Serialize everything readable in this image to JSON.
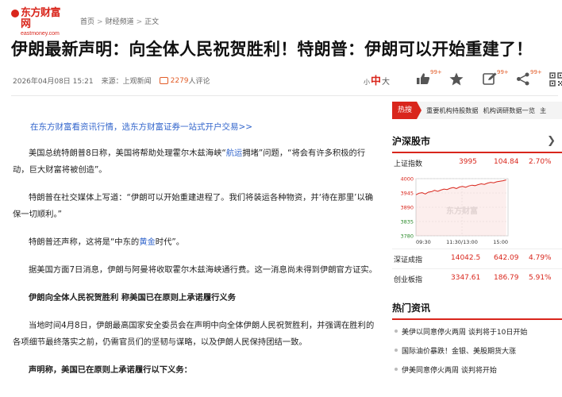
{
  "header": {
    "logo_cn": "东方财富网",
    "logo_en": "eastmoney.com",
    "breadcrumb": [
      "首页",
      "财经频道",
      "正文"
    ],
    "breadcrumb_sep": ">"
  },
  "article": {
    "title": "伊朗最新声明：向全体人民祝贺胜利！特朗普：伊朗可以开始重建了！",
    "datetime": "2026年04月08日 15:21",
    "source": "来源：上观新闻",
    "comment_count": "2279",
    "comment_suffix": "人评论",
    "font_size": {
      "small": "小",
      "mid": "中",
      "large": "大"
    },
    "actions": [
      {
        "icon": "thumbs-up-icon",
        "badge": "99+"
      },
      {
        "icon": "star-icon",
        "badge": ""
      },
      {
        "icon": "edit-icon",
        "badge": "99+"
      },
      {
        "icon": "share-icon",
        "badge": "99+"
      },
      {
        "icon": "qrcode-icon",
        "badge": ""
      }
    ],
    "promo": "在东方财富看资讯行情，选东方财富证券一站式开户交易>>",
    "p1_a": "美国总统特朗普8日称，美国将帮助处理霍尔木兹海峡“",
    "p1_link": "航运",
    "p1_b": "拥堵”问题，“将会有许多积极的行动，巨大财富将被创造”。",
    "p2": "特朗普在社交媒体上写道：“伊朗可以开始重建进程了。我们将装运各种物资，并‘待在那里’以确保一切顺利。”",
    "p3_a": "特朗普还声称，这将是“中东的",
    "p3_link": "黄金",
    "p3_b": "时代”。",
    "p4": "据美国方面7日消息，伊朗与阿曼将收取霍尔木兹海峡通行费。这一消息尚未得到伊朗官方证实。",
    "h1": "伊朗向全体人民祝贺胜利 称美国已在原则上承诺履行义务",
    "p5": "当地时间4月8日，伊朗最高国家安全委员会在声明中向全体伊朗人民祝贺胜利，并强调在胜利的各项细节最终落实之前，仍需官员们的坚韧与谋略，以及伊朗人民保持团结一致。",
    "h2": "声明称，美国已在原则上承诺履行以下义务："
  },
  "sidebar": {
    "hot_label": "热搜",
    "hot_items": [
      "重要机构持股数据",
      "机构调研数据一览",
      "主"
    ],
    "market_title": "沪深股市",
    "indices": [
      {
        "name": "上证指数",
        "price": "3995",
        "change": "104.84",
        "pct": "2.70%"
      },
      {
        "name": "深证成指",
        "price": "14042.5",
        "change": "642.09",
        "pct": "4.79%"
      },
      {
        "name": "创业板指",
        "price": "3347.61",
        "change": "186.79",
        "pct": "5.91%"
      }
    ],
    "news_title": "热门资讯",
    "news": [
      "美伊以同意停火两周 谈判将于10日开始",
      "国际油价暴跌！金银、美股期货大涨",
      "伊美同意停火两周 谈判将开始"
    ],
    "colors": {
      "accent": "#d9261c",
      "link": "#3366cc",
      "up": "#d9261c"
    }
  },
  "chart_data": {
    "type": "line",
    "title": "",
    "watermark": "东方财富",
    "x_ticks": [
      "09:30",
      "11:30/13:00",
      "15:00"
    ],
    "y_ticks": [
      "4000",
      "3945",
      "3890",
      "3835",
      "3780"
    ],
    "ylim": [
      3780,
      4000
    ],
    "reference": 3890,
    "series": [
      {
        "values": [
          3938,
          3944,
          3946,
          3941,
          3948,
          3950,
          3955,
          3951,
          3956,
          3960,
          3958,
          3963,
          3966,
          3962,
          3968,
          3970,
          3967,
          3972,
          3975,
          3973,
          3977,
          3980,
          3978,
          3983,
          3986,
          3984,
          3988,
          3990,
          3992,
          3995
        ]
      }
    ]
  }
}
